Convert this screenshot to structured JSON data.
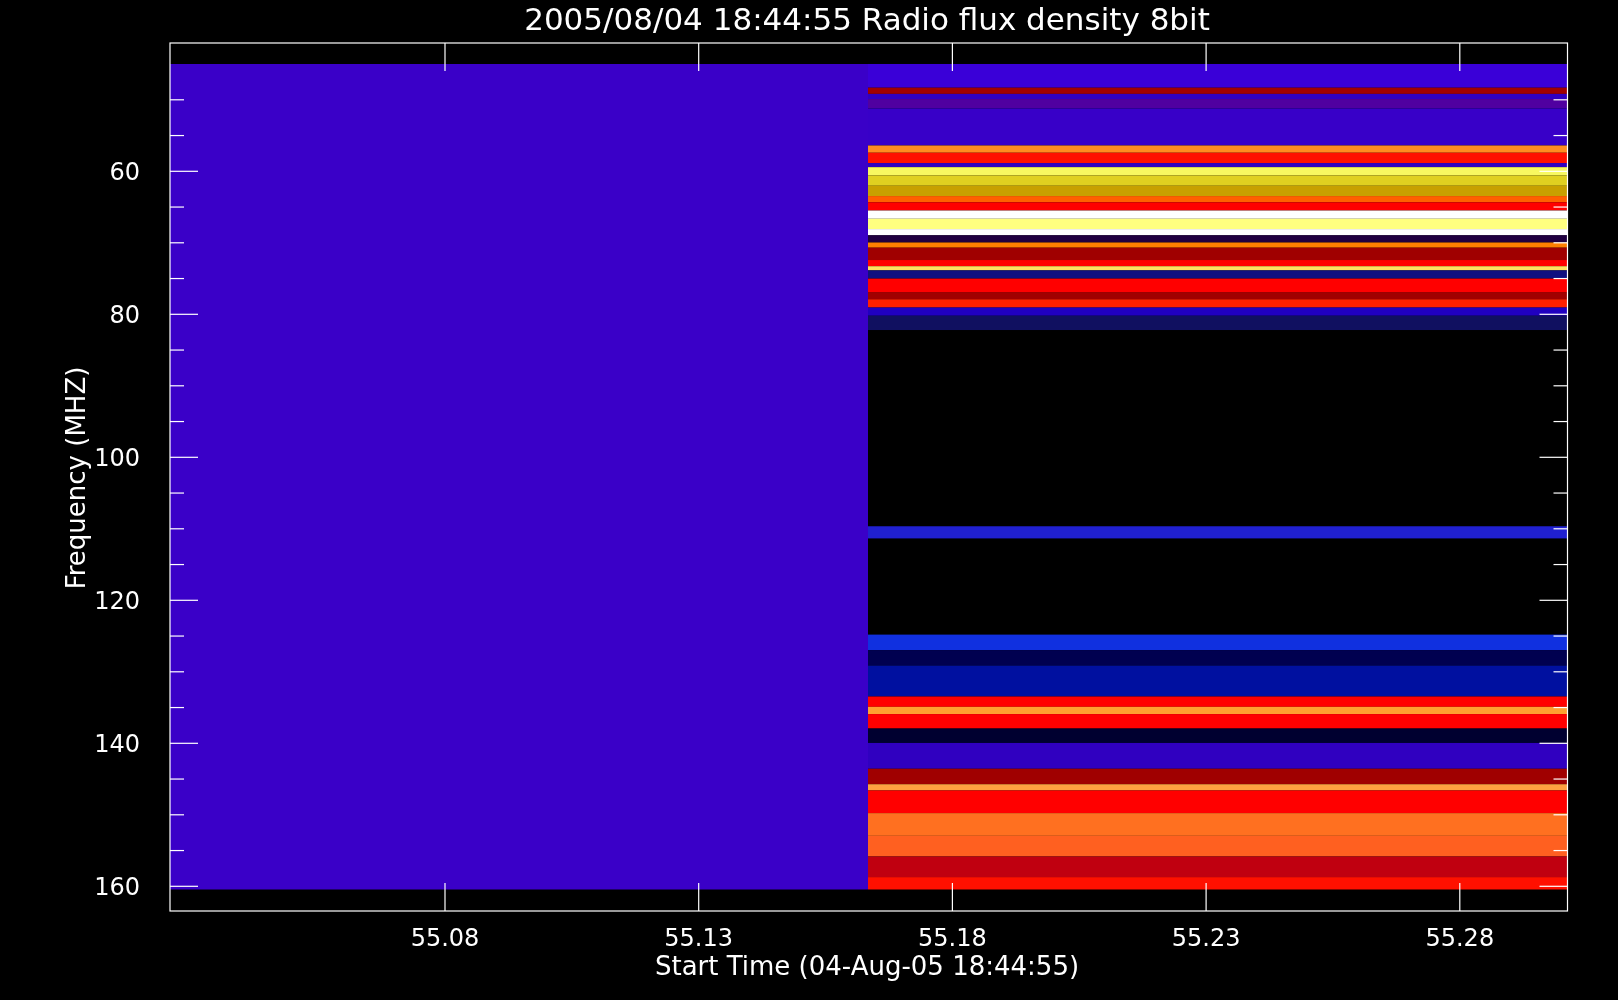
{
  "plot": {
    "title": "2005/08/04 18:44:55 Radio flux density 8bit",
    "xlabel": "Start Time (04-Aug-05 18:44:55)",
    "ylabel": "Frequency (MHZ)",
    "xticks": [
      "55.08",
      "55.13",
      "55.18",
      "55.23",
      "55.28"
    ],
    "yticks": [
      "60",
      "80",
      "100",
      "120",
      "140",
      "160"
    ]
  }
}
